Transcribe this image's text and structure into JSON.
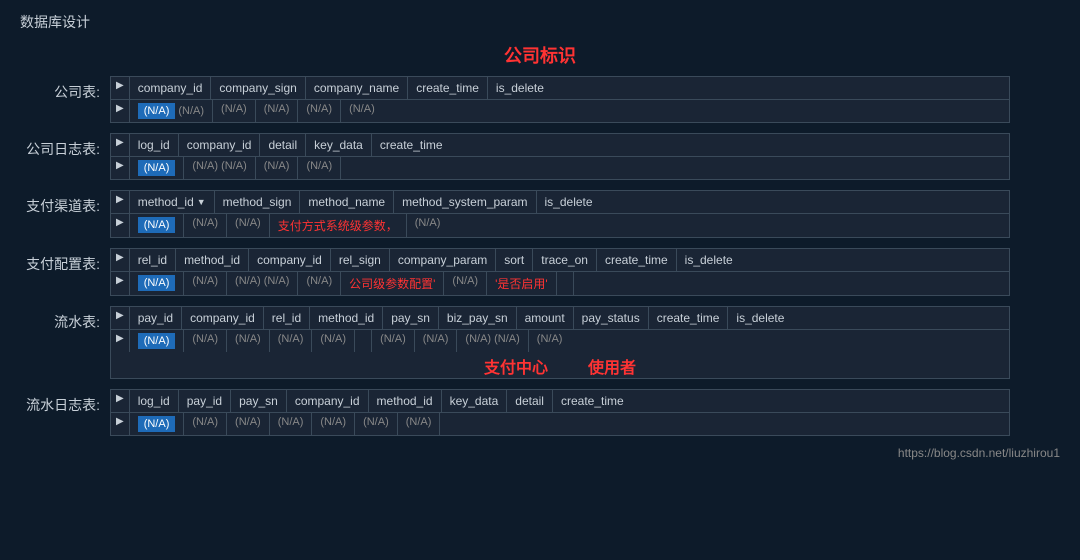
{
  "page": {
    "title": "数据库设计",
    "center_label": "公司标识",
    "footer_link": "https://blog.csdn.net/liuzhirou1"
  },
  "tables": [
    {
      "label": "公司表:",
      "headers": [
        "company_id",
        "company_sign",
        "company_name",
        "create_time",
        "is_delete"
      ],
      "has_sort": [],
      "data_row": [
        "(N/A) (N/A)",
        "(N/A)",
        "(N/A)",
        "(N/A)",
        "(N/A)"
      ],
      "highlight_col": 0,
      "red_cells": []
    },
    {
      "label": "公司日志表:",
      "headers": [
        "log_id",
        "company_id",
        "detail",
        "key_data",
        "create_time"
      ],
      "has_sort": [],
      "data_row": [
        "(N/A)",
        "(N/A) (N/A)",
        "(N/A)",
        "(N/A)",
        ""
      ],
      "highlight_col": 0,
      "red_cells": []
    },
    {
      "label": "支付渠道表:",
      "headers": [
        "method_id",
        "method_sign",
        "method_name",
        "method_system_param",
        "is_delete"
      ],
      "has_sort": [
        0
      ],
      "data_row": [
        "(N/A)",
        "(N/A)",
        "(N/A)",
        "支付方式系统级参数，",
        "(N/A)"
      ],
      "highlight_col": 0,
      "red_cells": [
        3
      ]
    },
    {
      "label": "支付配置表:",
      "headers": [
        "rel_id",
        "method_id",
        "company_id",
        "rel_sign",
        "company_param",
        "sort",
        "trace_on",
        "create_time",
        "is_delete"
      ],
      "has_sort": [],
      "data_row": [
        "(N/A)",
        "(N/A)",
        "(N/A) (N/A)",
        "(N/A)",
        "公司级参数配置'",
        "(N/A)",
        "'是否启用'",
        "",
        ""
      ],
      "highlight_col": 0,
      "red_cells": [
        4,
        6
      ]
    },
    {
      "label": "流水表:",
      "headers": [
        "pay_id",
        "company_id",
        "rel_id",
        "method_id",
        "pay_sn",
        "biz_pay_sn",
        "amount",
        "pay_status",
        "create_time",
        "is_delete"
      ],
      "has_sort": [],
      "data_row": [
        "(N/A)",
        "(N/A)",
        "(N/A)",
        "(N/A)",
        "(N/A)",
        "",
        "(N/A)",
        "(N/A)",
        "(N/A) (N/A)",
        "(N/A)"
      ],
      "highlight_col": 0,
      "annotations": [
        "支付中心",
        "使用者"
      ]
    },
    {
      "label": "流水日志表:",
      "headers": [
        "log_id",
        "pay_id",
        "pay_sn",
        "company_id",
        "method_id",
        "key_data",
        "detail",
        "create_time"
      ],
      "has_sort": [],
      "data_row": [
        "(N/A)",
        "(N/A)",
        "(N/A)",
        "(N/A)",
        "(N/A)",
        "(N/A)",
        "(N/A)",
        ""
      ],
      "highlight_col": 0,
      "red_cells": []
    }
  ]
}
